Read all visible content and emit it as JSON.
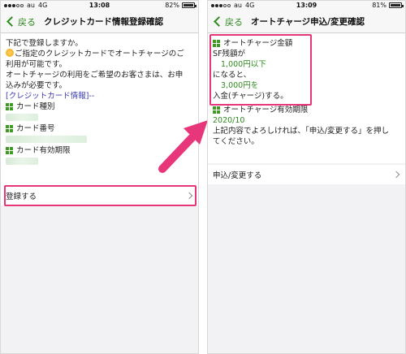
{
  "left": {
    "status": {
      "carrier": "au",
      "network": "4G",
      "time": "13:08",
      "battery": "82%",
      "battery_level": 0.82
    },
    "nav": {
      "back": "戻る",
      "title": "クレジットカード情報登録確認"
    },
    "body": {
      "line1": "下記で登録しますか。",
      "notice_lines": [
        "ご指定のクレジットカードでオートチャージのご",
        "利用が可能です。",
        "オートチャージの利用をご希望のお客さまは、お申",
        "込みが必要です。"
      ],
      "section_title": "[クレジットカード情報]--",
      "labels": [
        "カード種別",
        "カード番号",
        "カード有効期限"
      ]
    },
    "register_button": "登録する"
  },
  "right": {
    "status": {
      "carrier": "au",
      "network": "4G",
      "time": "13:09",
      "battery": "81%",
      "battery_level": 0.81
    },
    "nav": {
      "back": "戻る",
      "title": "オートチャージ申込/変更確認"
    },
    "amount": {
      "heading": "オートチャージ金額",
      "line1": "SF残額が",
      "threshold": "1,000円以下",
      "line3": "になると、",
      "charge": "3,000円を",
      "line5": "入金(チャージ)する。"
    },
    "expiry": {
      "heading": "オートチャージ有効期限",
      "value": "2020/10"
    },
    "confirm_text": [
      "上記内容でよろしければ、「申込/変更する」を押し",
      "てください。"
    ],
    "apply_button": "申込/変更する"
  },
  "colors": {
    "accent_green": "#2e8b1e",
    "highlight_pink": "#e8367a"
  }
}
